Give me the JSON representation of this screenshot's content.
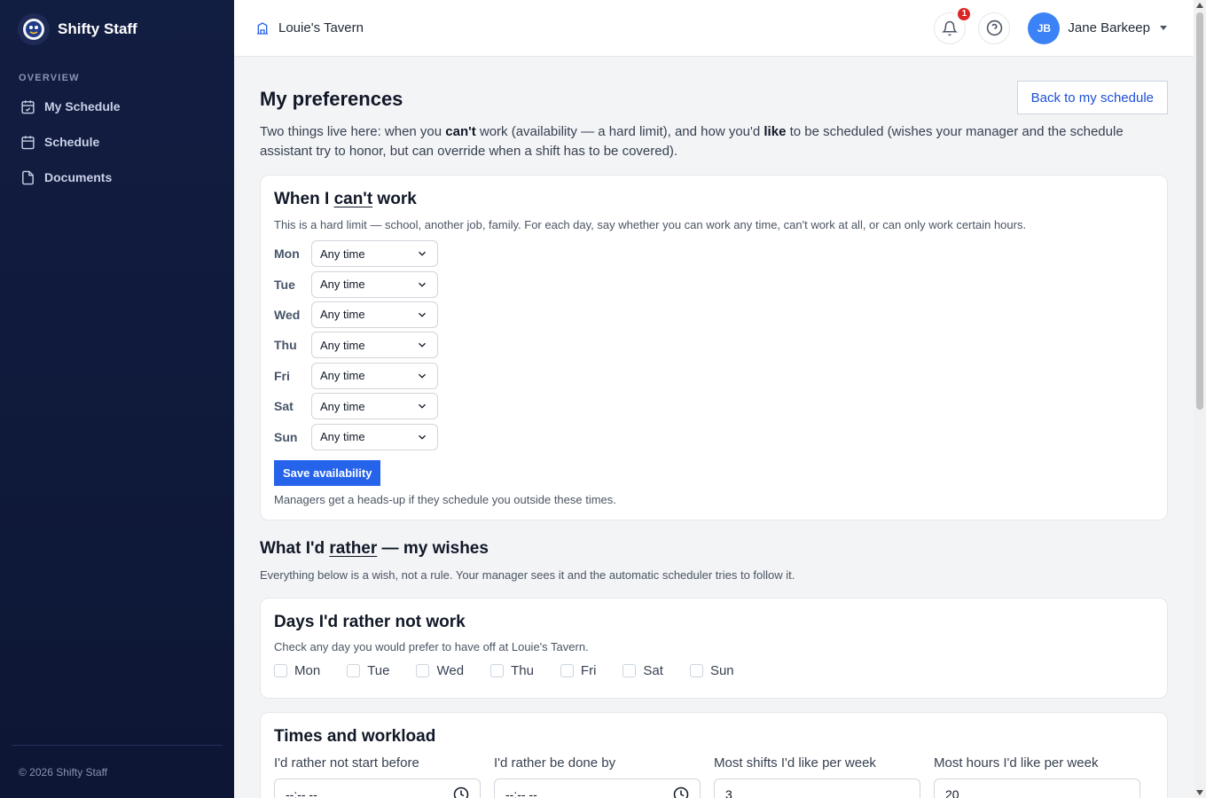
{
  "app": {
    "name": "Shifty Staff",
    "footer": "© 2026 Shifty Staff"
  },
  "sidebar": {
    "section_label": "OVERVIEW",
    "items": [
      {
        "label": "My Schedule",
        "icon": "calendar-check-icon"
      },
      {
        "label": "Schedule",
        "icon": "calendar-icon"
      },
      {
        "label": "Documents",
        "icon": "document-icon"
      }
    ]
  },
  "topbar": {
    "venue": "Louie's Tavern",
    "notification_count": "1",
    "user_initials": "JB",
    "user_name": "Jane Barkeep"
  },
  "page": {
    "title": "My preferences",
    "back_button": "Back to my schedule",
    "intro": {
      "part1": "Two things live here: when you ",
      "bold1": "can't",
      "part2": " work (availability — a hard limit), and how you'd ",
      "bold2": "like",
      "part3": " to be scheduled (wishes your manager and the schedule assistant try to honor, but can override when a shift has to be covered)."
    }
  },
  "availability": {
    "title_pre": "When I ",
    "title_underline": "can't",
    "title_post": " work",
    "description": "This is a hard limit — school, another job, family. For each day, say whether you can work any time, can't work at all, or can only work certain hours.",
    "days": [
      {
        "day": "Mon",
        "value": "Any time"
      },
      {
        "day": "Tue",
        "value": "Any time"
      },
      {
        "day": "Wed",
        "value": "Any time"
      },
      {
        "day": "Thu",
        "value": "Any time"
      },
      {
        "day": "Fri",
        "value": "Any time"
      },
      {
        "day": "Sat",
        "value": "Any time"
      },
      {
        "day": "Sun",
        "value": "Any time"
      }
    ],
    "save_button": "Save availability",
    "note": "Managers get a heads-up if they schedule you outside these times."
  },
  "wishes": {
    "title_pre": "What I'd ",
    "title_underline": "rather",
    "title_post": " — my wishes",
    "description": "Everything below is a wish, not a rule. Your manager sees it and the automatic scheduler tries to follow it."
  },
  "days_off": {
    "title": "Days I'd rather not work",
    "description": "Check any day you would prefer to have off at Louie's Tavern.",
    "days": [
      {
        "label": "Mon",
        "checked": false
      },
      {
        "label": "Tue",
        "checked": false
      },
      {
        "label": "Wed",
        "checked": false
      },
      {
        "label": "Thu",
        "checked": false
      },
      {
        "label": "Fri",
        "checked": false
      },
      {
        "label": "Sat",
        "checked": false
      },
      {
        "label": "Sun",
        "checked": false
      }
    ]
  },
  "workload": {
    "title": "Times and workload",
    "fields": [
      {
        "label": "I'd rather not start before",
        "value": "--:-- --",
        "icon": "clock-icon"
      },
      {
        "label": "I'd rather be done by",
        "value": "--:-- --",
        "icon": "clock-icon"
      },
      {
        "label": "Most shifts I'd like per week",
        "value": "3"
      },
      {
        "label": "Most hours I'd like per week",
        "value": "20"
      }
    ]
  },
  "colors": {
    "sidebar": "#121d42",
    "primary": "#2563eb",
    "badge": "#dc2626",
    "avatar": "#3b82f6"
  }
}
